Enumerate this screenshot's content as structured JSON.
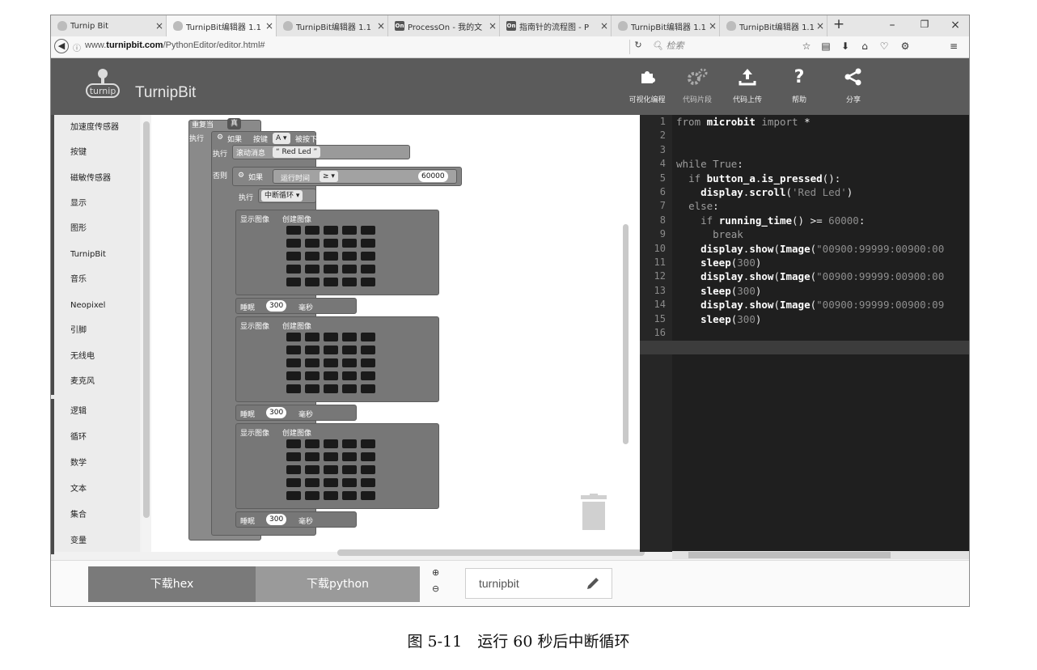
{
  "browser": {
    "tabs": [
      {
        "title": "Turnip Bit",
        "icon": "turnip-icon"
      },
      {
        "title": "TurnipBit编辑器 1.1",
        "icon": "turnip-icon"
      },
      {
        "title": "TurnipBit编辑器 1.1",
        "icon": "turnip-icon"
      },
      {
        "title": "ProcessOn - 我的文",
        "icon": "on-icon"
      },
      {
        "title": "指南针的流程图 - P",
        "icon": "on-icon"
      },
      {
        "title": "TurnipBit编辑器 1.1",
        "icon": "turnip-icon"
      },
      {
        "title": "TurnipBit编辑器 1.1",
        "icon": "turnip-icon"
      }
    ],
    "tab_close": "×",
    "new_tab": "+",
    "url_prefix": "www.",
    "url_domain": "turnipbit.com",
    "url_path": "/PythonEditor/editor.html#",
    "search_placeholder": "检索"
  },
  "app": {
    "title": "TurnipBit",
    "logo_text": "turnip",
    "toolbar": [
      {
        "label": "可视化编程",
        "icon": "puzzle-icon"
      },
      {
        "label": "代码片段",
        "icon": "gears-icon"
      },
      {
        "label": "代码上传",
        "icon": "upload-icon"
      },
      {
        "label": "帮助",
        "icon": "help-icon"
      },
      {
        "label": "分享",
        "icon": "share-icon"
      }
    ]
  },
  "categories": [
    "加速度传感器",
    "按键",
    "磁敏传感器",
    "显示",
    "图形",
    "TurnipBit",
    "音乐",
    "Neopixel",
    "引脚",
    "无线电",
    "麦克风",
    "逻辑",
    "循环",
    "数学",
    "文本",
    "集合",
    "变量"
  ],
  "blocks": {
    "repeat_label": "重复当",
    "true_label": "真",
    "do_label": "执行",
    "if_label": "如果",
    "button_label": "按键",
    "button_value": "A",
    "pressed_label": "被按下",
    "scroll_label": "滚动消息",
    "scroll_text": "Red Led",
    "else_label": "否则",
    "running_time_label": "运行时间",
    "compare_op": "≥",
    "threshold": "60000",
    "break_label": "中断循环",
    "show_image_label": "显示图像",
    "create_image_label": "创建图像",
    "sleep_label": "睡眠",
    "sleep_value": "300",
    "ms_label": "毫秒"
  },
  "code_lines": [
    "from microbit import *",
    "",
    "",
    "while True:",
    "  if button_a.is_pressed():",
    "    display.scroll('Red Led')",
    "  else:",
    "    if running_time() >= 60000:",
    "      break",
    "    display.show(Image(\"00900:99999:00900:00",
    "    sleep(300)",
    "    display.show(Image(\"00900:99999:00900:00",
    "    sleep(300)",
    "    display.show(Image(\"00900:99999:00900:09",
    "    sleep(300)",
    ""
  ],
  "bottom": {
    "download_hex": "下载hex",
    "download_python": "下载python",
    "project_name": "turnipbit"
  },
  "caption": "图 5-11　运行 60 秒后中断循环"
}
